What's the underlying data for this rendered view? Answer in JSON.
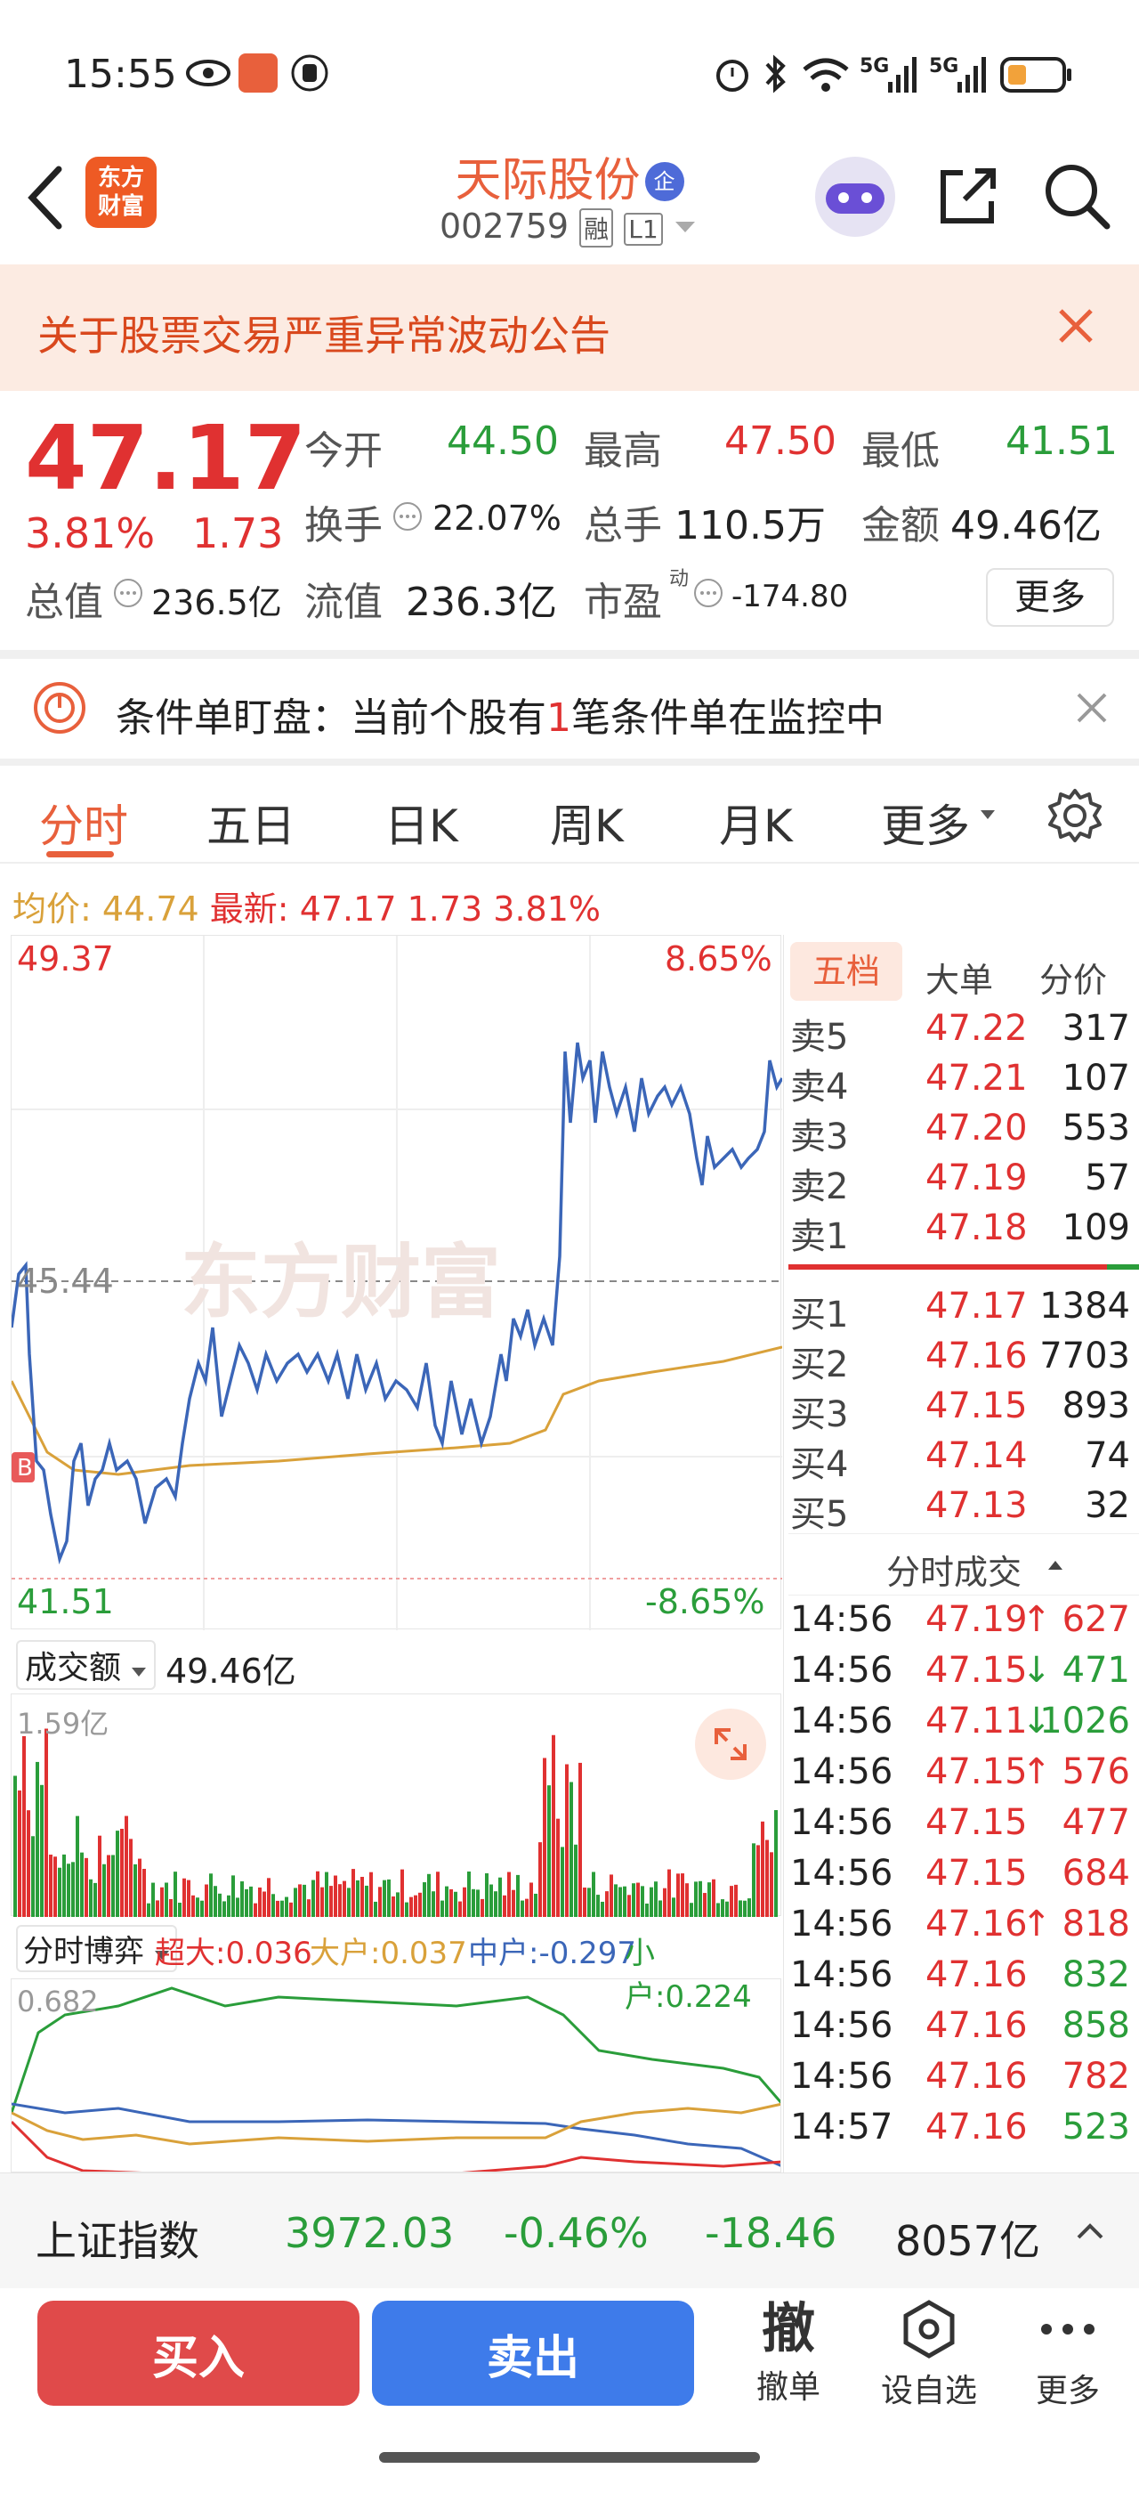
{
  "status": {
    "time": "15:55",
    "net1": "5G",
    "net2": "5G"
  },
  "header": {
    "app_logo": "东方\n财富",
    "stock_name": "天际股份",
    "badge": "企",
    "code": "002759",
    "tag1": "融",
    "tag2": "L1"
  },
  "notice": {
    "text": "关于股票交易严重异常波动公告"
  },
  "quote": {
    "price": "47.17",
    "pct": "3.81%",
    "chg": "1.73",
    "open_label": "今开",
    "open": "44.50",
    "high_label": "最高",
    "high": "47.50",
    "low_label": "最低",
    "low": "41.51",
    "turnover_label": "换手",
    "turnover": "22.07%",
    "vol_label": "总手",
    "vol": "110.5万",
    "amount_label": "金额",
    "amount": "49.46亿",
    "mcap_label": "总值",
    "mcap": "236.5亿",
    "float_label": "流值",
    "float": "236.3亿",
    "pe_label": "市盈",
    "pe_sup": "动",
    "pe": "-174.80",
    "more": "更多"
  },
  "alert": {
    "prefix": "条件单盯盘：当前个股有",
    "count": "1",
    "suffix": "笔条件单在监控中"
  },
  "tabs": [
    "分时",
    "五日",
    "日K",
    "周K",
    "月K",
    "更多"
  ],
  "summary": {
    "avg_label": "均价:",
    "avg": "44.74",
    "last_label": "最新:",
    "last": "47.17",
    "chg": "1.73",
    "pct": "3.81%"
  },
  "chart": {
    "ymax": "49.37",
    "ymid": "45.44",
    "ymin": "41.51",
    "pmax": "8.65%",
    "pmin": "-8.65%",
    "marker": "B",
    "watermark": "东方财富"
  },
  "volume": {
    "label": "成交额",
    "value": "49.46亿",
    "ymax": "1.59亿"
  },
  "flow": {
    "label": "分时博弈",
    "super": "超大:0.036",
    "large": "大户:0.037",
    "mid": "中户:-0.297",
    "small": "小户:0.224",
    "ymax": "0.682"
  },
  "orderbook": {
    "tabs": [
      "五档",
      "大单",
      "分价"
    ],
    "asks": [
      {
        "label": "卖5",
        "price": "47.22",
        "vol": "317"
      },
      {
        "label": "卖4",
        "price": "47.21",
        "vol": "107"
      },
      {
        "label": "卖3",
        "price": "47.20",
        "vol": "553"
      },
      {
        "label": "卖2",
        "price": "47.19",
        "vol": "57"
      },
      {
        "label": "卖1",
        "price": "47.18",
        "vol": "109"
      }
    ],
    "bids": [
      {
        "label": "买1",
        "price": "47.17",
        "vol": "1384"
      },
      {
        "label": "买2",
        "price": "47.16",
        "vol": "7703"
      },
      {
        "label": "买3",
        "price": "47.15",
        "vol": "893"
      },
      {
        "label": "买4",
        "price": "47.14",
        "vol": "74"
      },
      {
        "label": "买5",
        "price": "47.13",
        "vol": "32"
      }
    ]
  },
  "ticks": {
    "title": "分时成交",
    "rows": [
      {
        "time": "14:56",
        "price": "47.19",
        "dir": "↑",
        "vol": "627",
        "color": "red"
      },
      {
        "time": "14:56",
        "price": "47.15",
        "dir": "↓",
        "vol": "471",
        "color": "green"
      },
      {
        "time": "14:56",
        "price": "47.11",
        "dir": "↓",
        "vol": "1026",
        "color": "green"
      },
      {
        "time": "14:56",
        "price": "47.15",
        "dir": "↑",
        "vol": "576",
        "color": "red"
      },
      {
        "time": "14:56",
        "price": "47.15",
        "dir": "",
        "vol": "477",
        "color": "red"
      },
      {
        "time": "14:56",
        "price": "47.15",
        "dir": "",
        "vol": "684",
        "color": "red"
      },
      {
        "time": "14:56",
        "price": "47.16",
        "dir": "↑",
        "vol": "818",
        "color": "red"
      },
      {
        "time": "14:56",
        "price": "47.16",
        "dir": "",
        "vol": "832",
        "color": "green"
      },
      {
        "time": "14:56",
        "price": "47.16",
        "dir": "",
        "vol": "858",
        "color": "green"
      },
      {
        "time": "14:56",
        "price": "47.16",
        "dir": "",
        "vol": "782",
        "color": "red"
      },
      {
        "time": "14:57",
        "price": "47.16",
        "dir": "",
        "vol": "523",
        "color": "green"
      }
    ]
  },
  "index_bar": {
    "name": "上证指数",
    "value": "3972.03",
    "pct": "-0.46%",
    "chg": "-18.46",
    "amount": "8057亿"
  },
  "actions": {
    "buy": "买入",
    "sell": "卖出",
    "cancel_glyph": "撤",
    "cancel": "撤单",
    "watch": "设自选",
    "more": "更多"
  },
  "colors": {
    "up": "#e03131",
    "down": "#2a9d3a",
    "line": "#3b66b8",
    "avg": "#d9a13a",
    "buy": "#e04a4a",
    "sell": "#3e7bea"
  }
}
